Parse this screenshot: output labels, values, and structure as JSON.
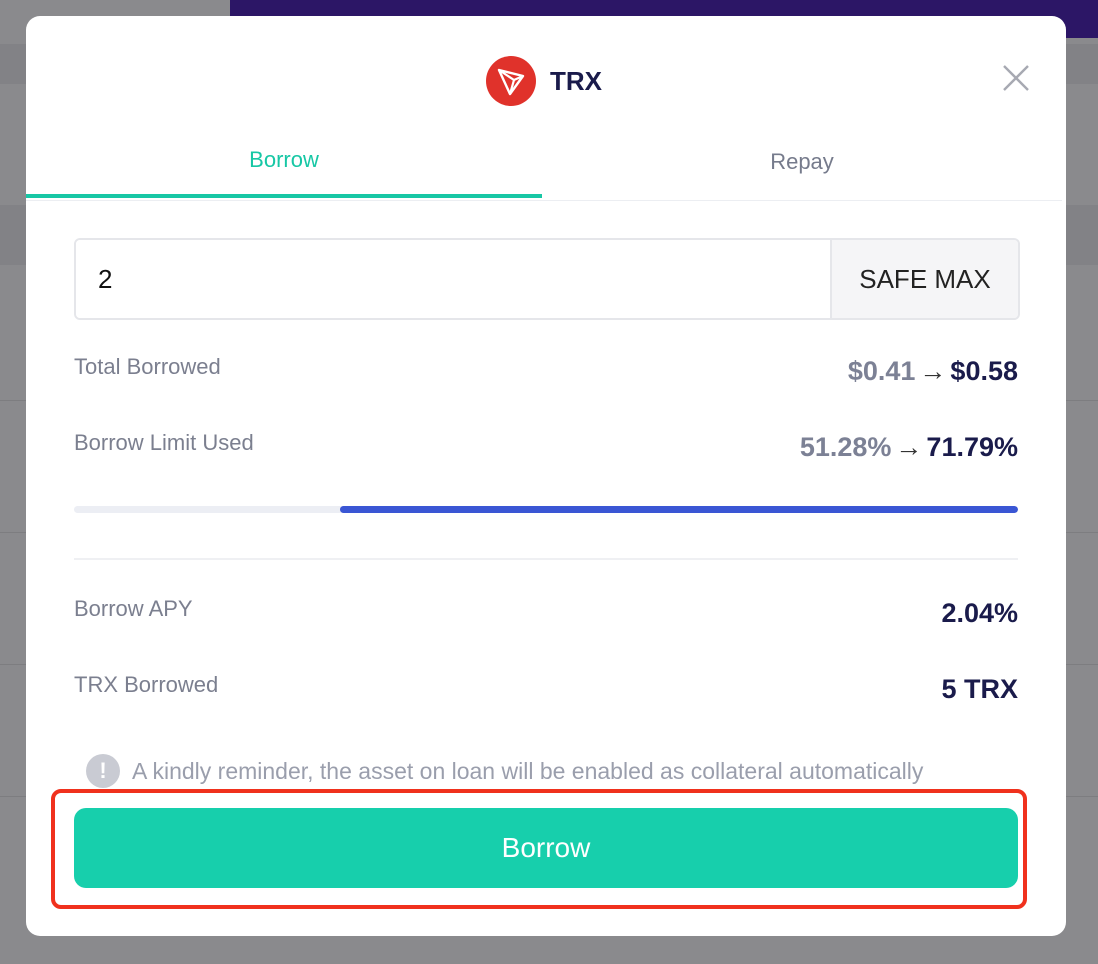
{
  "token": {
    "symbol": "TRX",
    "icon": "tron-logo-icon",
    "brand_color": "#e0322b"
  },
  "tabs": [
    {
      "label": "Borrow",
      "active": true
    },
    {
      "label": "Repay",
      "active": false
    }
  ],
  "amount_input": {
    "value": "2"
  },
  "safe_max_label": "SAFE MAX",
  "total_borrowed": {
    "label": "Total Borrowed",
    "from": "$0.41",
    "arrow": "→",
    "to": "$0.58"
  },
  "borrow_limit": {
    "label": "Borrow Limit Used",
    "from": "51.28%",
    "arrow": "→",
    "to": "71.79%",
    "progress_fraction": 0.7179
  },
  "borrow_apy": {
    "label": "Borrow APY",
    "value": "2.04%"
  },
  "trx_borrowed": {
    "label": "TRX Borrowed",
    "value": "5 TRX"
  },
  "reminder": {
    "icon": "info-exclamation-icon",
    "text": "A kindly reminder, the asset on loan will be enabled as collateral automatically"
  },
  "borrow_button_label": "Borrow",
  "colors": {
    "accent": "#17c7a5",
    "progress": "#3a56d4",
    "highlight": "#f0311d",
    "title": "#1a1b4b"
  }
}
